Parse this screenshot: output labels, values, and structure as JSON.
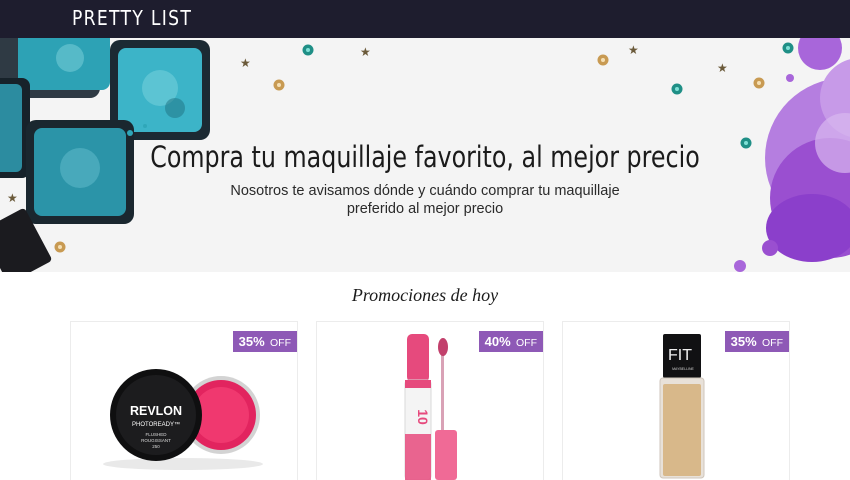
{
  "header": {
    "brand": "PRETTY LIST"
  },
  "hero": {
    "title": "Compra tu maquillaje favorito, al mejor precio",
    "subtitle": "Nosotros te avisamos dónde y cuándo comprar tu maquillaje preferido al mejor precio"
  },
  "promotions": {
    "title": "Promociones de hoy",
    "cards": [
      {
        "discount": "35%",
        "off_label": "OFF",
        "product_text": [
          "REVLON",
          "PHOTOREADY™",
          "FLUSHED",
          "ROUGISSANT",
          "250"
        ]
      },
      {
        "discount": "40%",
        "off_label": "OFF",
        "product_text": [
          "10"
        ]
      },
      {
        "discount": "35%",
        "off_label": "OFF",
        "product_text": [
          "FIT",
          "MAYBELLINE"
        ]
      }
    ]
  },
  "colors": {
    "topbar": "#1e1d2e",
    "badge": "#8e59b6",
    "accent_teal": "#2fa7b9",
    "accent_purple": "#9a4fd0"
  }
}
